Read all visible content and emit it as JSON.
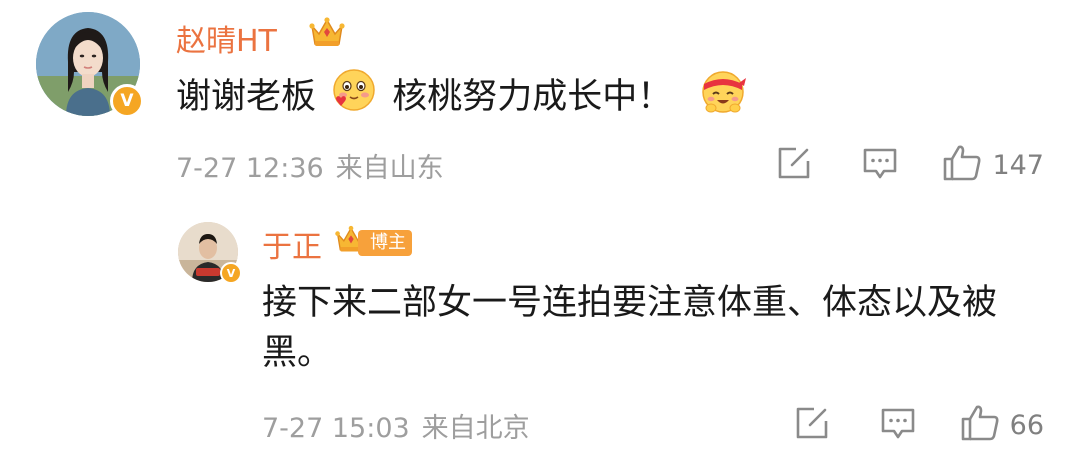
{
  "comments": [
    {
      "username": "赵晴HT",
      "text_part1": "谢谢老板",
      "text_part2": "核桃努力成长中！",
      "time": "7-27 12:36",
      "location": "来自山东",
      "likes": "147",
      "verified": "V"
    },
    {
      "username": "于正",
      "role_badge": "博主",
      "text": "接下来二部女一号连拍要注意体重、体态以及被黑。",
      "time": "7-27 15:03",
      "location": "来自北京",
      "likes": "66",
      "verified": "V"
    }
  ],
  "colors": {
    "username": "#eb7340",
    "meta": "#9e9e9e",
    "badge": "#f7a13b",
    "verified": "#f5a623"
  },
  "icons": [
    "crown-icon",
    "share-icon",
    "reply-icon",
    "like-icon",
    "blush-emoji",
    "headband-emoji"
  ]
}
